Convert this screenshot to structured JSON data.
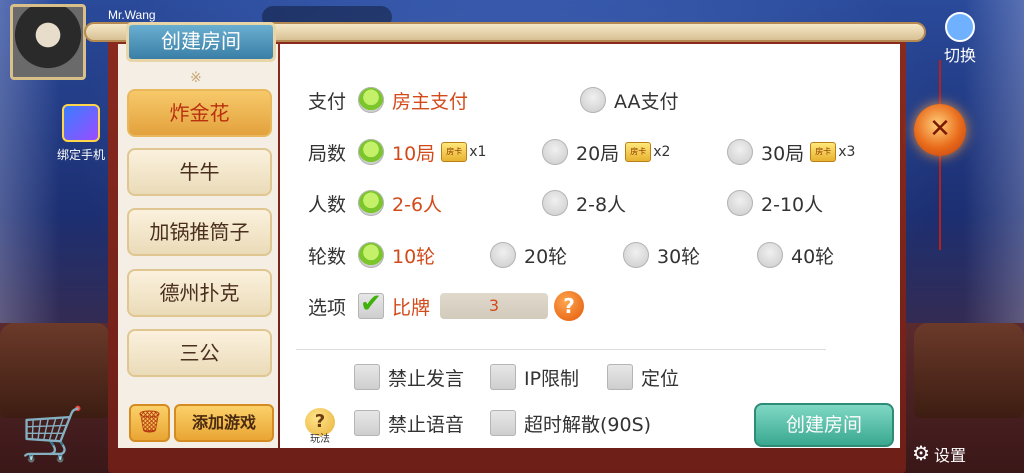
{
  "hud": {
    "player_name": "Mr.Wang",
    "bind_phone_label": "绑定手机",
    "switch_label": "切换",
    "settings_label": "设置"
  },
  "dialog": {
    "title": "创建房间",
    "sidebar": {
      "ornament": "※",
      "items": [
        {
          "label": "炸金花",
          "active": true
        },
        {
          "label": "牛牛"
        },
        {
          "label": "加锅推筒子"
        },
        {
          "label": "德州扑克"
        },
        {
          "label": "三公"
        }
      ],
      "trash_icon": "🗑",
      "add_game_label": "添加游戏"
    },
    "payment": {
      "label": "支付",
      "options": [
        "房主支付",
        "AA支付"
      ],
      "selected": 0
    },
    "rounds_count": {
      "label": "局数",
      "options": [
        {
          "text": "10局",
          "card_text": "房卡",
          "multiplier": "x1"
        },
        {
          "text": "20局",
          "card_text": "房卡",
          "multiplier": "x2"
        },
        {
          "text": "30局",
          "card_text": "房卡",
          "multiplier": "x3"
        }
      ],
      "selected": 0
    },
    "players": {
      "label": "人数",
      "options": [
        "2-6人",
        "2-8人",
        "2-10人"
      ],
      "selected": 0
    },
    "turns": {
      "label": "轮数",
      "options": [
        "10轮",
        "20轮",
        "30轮",
        "40轮"
      ],
      "selected": 0
    },
    "options_row": {
      "label": "选项",
      "compare_label": "比牌",
      "compare_checked": true,
      "compare_value": "3",
      "help_icon": "?"
    },
    "restrictions": [
      {
        "label": "禁止发言",
        "checked": false
      },
      {
        "label": "IP限制",
        "checked": false
      },
      {
        "label": "定位",
        "checked": false
      },
      {
        "label": "禁止语音",
        "checked": false
      },
      {
        "label": "超时解散(90S)",
        "checked": false
      }
    ],
    "rules_button": {
      "icon": "?",
      "label": "玩法"
    },
    "create_button_label": "创建房间",
    "close_icon": "✕"
  },
  "colors": {
    "selected_text": "#d34a1a",
    "create_button": "#3aa890",
    "sidebar_active": "#e3a23e"
  }
}
